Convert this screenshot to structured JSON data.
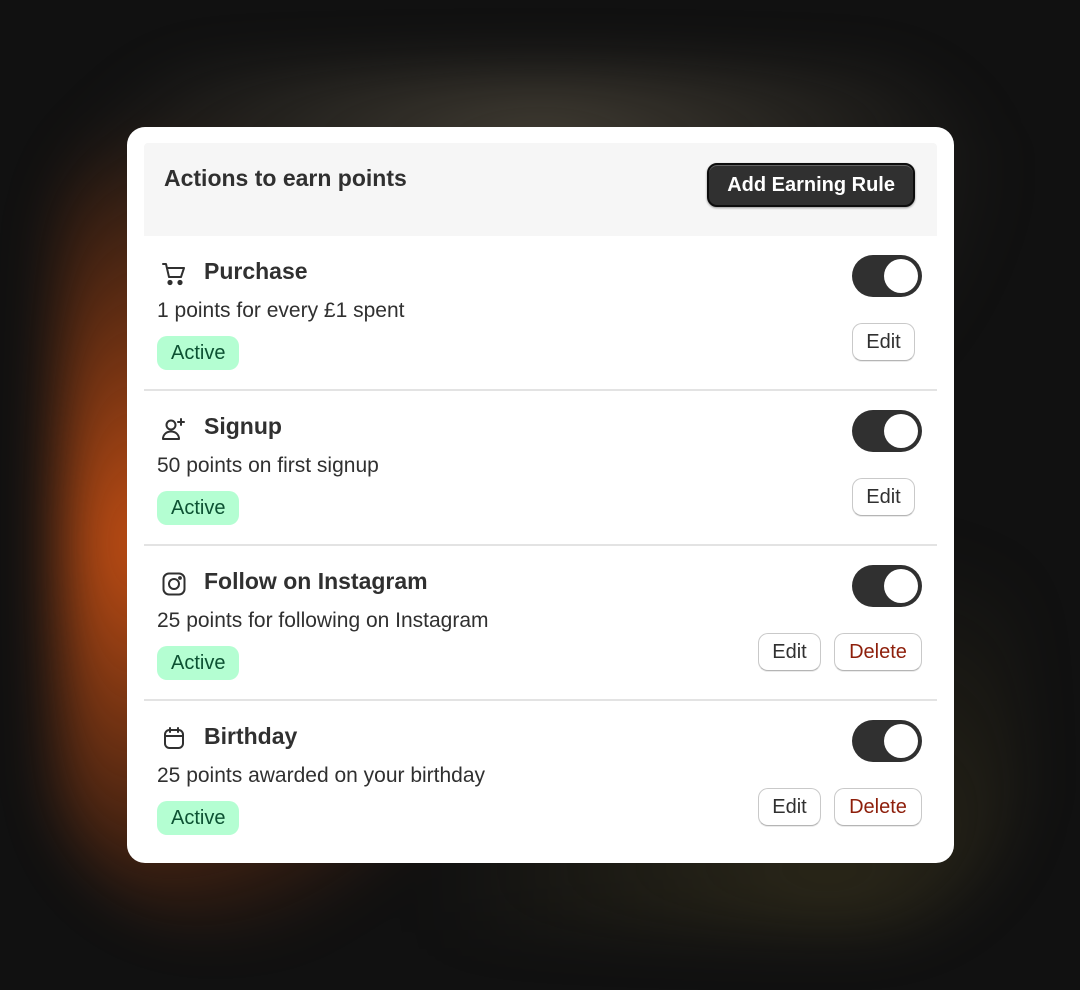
{
  "header": {
    "title": "Actions to earn points",
    "add_button_label": "Add Earning Rule"
  },
  "rules": [
    {
      "icon": "shopping-cart-icon",
      "title": "Purchase",
      "description": "1 points for every £1 spent",
      "status": "Active",
      "enabled": true,
      "edit_label": "Edit"
    },
    {
      "icon": "person-add-icon",
      "title": "Signup",
      "description": "50 points on first signup",
      "status": "Active",
      "enabled": true,
      "edit_label": "Edit"
    },
    {
      "icon": "instagram-icon",
      "title": "Follow on Instagram",
      "description": "25 points for following on Instagram",
      "status": "Active",
      "enabled": true,
      "edit_label": "Edit",
      "delete_label": "Delete"
    },
    {
      "icon": "calendar-icon",
      "title": "Birthday",
      "description": "25 points awarded on your birthday",
      "status": "Active",
      "enabled": true,
      "edit_label": "Edit",
      "delete_label": "Delete"
    }
  ],
  "colors": {
    "badge_bg": "#b4fed2",
    "badge_text": "#0c5132",
    "toggle_on": "#303030",
    "delete_text": "#8e1f0b"
  }
}
